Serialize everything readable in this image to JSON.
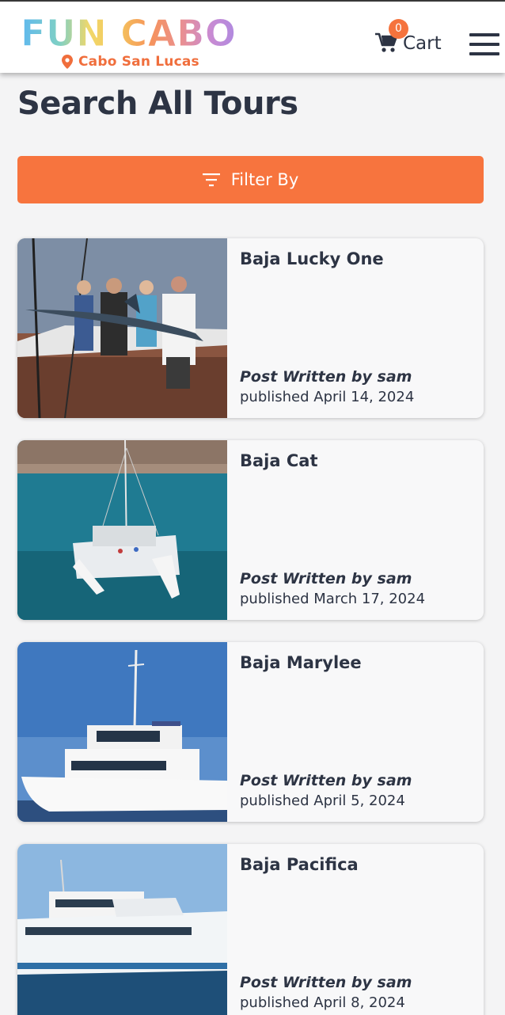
{
  "header": {
    "logo_text": "FUN CABO",
    "location": "Cabo San Lucas",
    "cart_label": "Cart",
    "cart_count": "0"
  },
  "page": {
    "title": "Search All Tours",
    "filter_label": "Filter By"
  },
  "tours": [
    {
      "title": "Baja Lucky One",
      "author": "Post Written by sam",
      "date": "published April 14, 2024"
    },
    {
      "title": "Baja Cat",
      "author": "Post Written by sam",
      "date": "published March 17, 2024"
    },
    {
      "title": "Baja Marylee",
      "author": "Post Written by sam",
      "date": "published April 5, 2024"
    },
    {
      "title": "Baja Pacifica",
      "author": "Post Written by sam",
      "date": "published April 8, 2024"
    }
  ],
  "colors": {
    "accent": "#f7743e",
    "text": "#2d3444",
    "background": "#f4f4f5"
  }
}
